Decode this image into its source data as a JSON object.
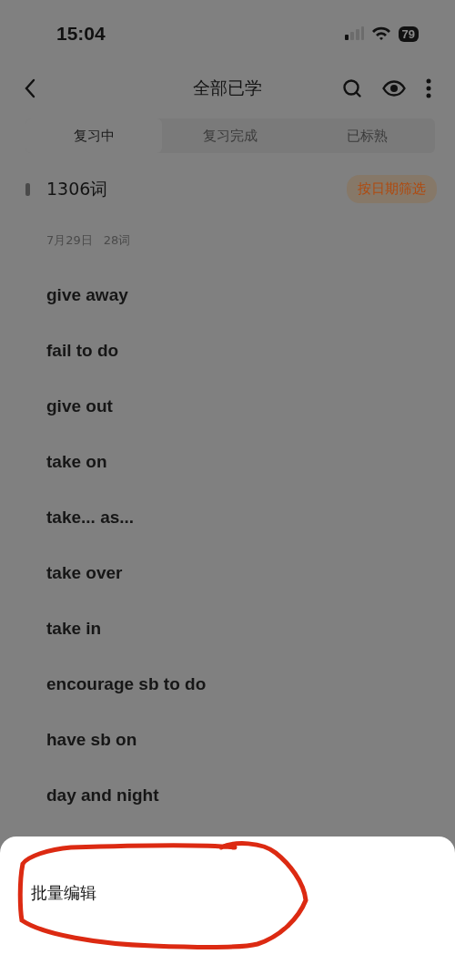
{
  "status_bar": {
    "time": "15:04",
    "battery": "79"
  },
  "header": {
    "title": "全部已学"
  },
  "tabs": [
    {
      "label": "复习中",
      "selected": true
    },
    {
      "label": "复习完成",
      "selected": false
    },
    {
      "label": "已标熟",
      "selected": false
    }
  ],
  "summary": {
    "count": "1306词",
    "filter_button": "按日期筛选"
  },
  "group": {
    "date": "7月29日",
    "count": "28词"
  },
  "words": [
    "give away",
    "fail to do",
    "give out",
    "take on",
    "take... as...",
    "take over",
    "take in",
    "encourage sb to do",
    "have sb on",
    "day and night"
  ],
  "sheet": {
    "items": [
      "批量编辑"
    ]
  }
}
